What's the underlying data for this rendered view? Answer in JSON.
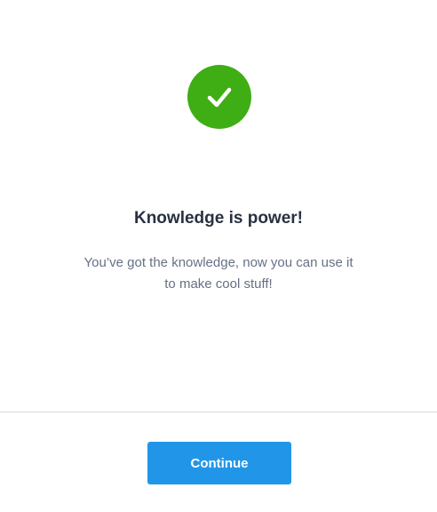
{
  "dialog": {
    "icon": "check-circle-icon",
    "title": "Knowledge is power!",
    "message_lines": [
      "You’ve got the knowledge, now you can use it",
      "to make cool stuff!"
    ],
    "continue_label": "Continue"
  },
  "colors": {
    "success": "#3fae15",
    "primary_button": "#2196e8",
    "title_text": "#273142",
    "body_text": "#667085",
    "divider": "#d6d8dc"
  }
}
